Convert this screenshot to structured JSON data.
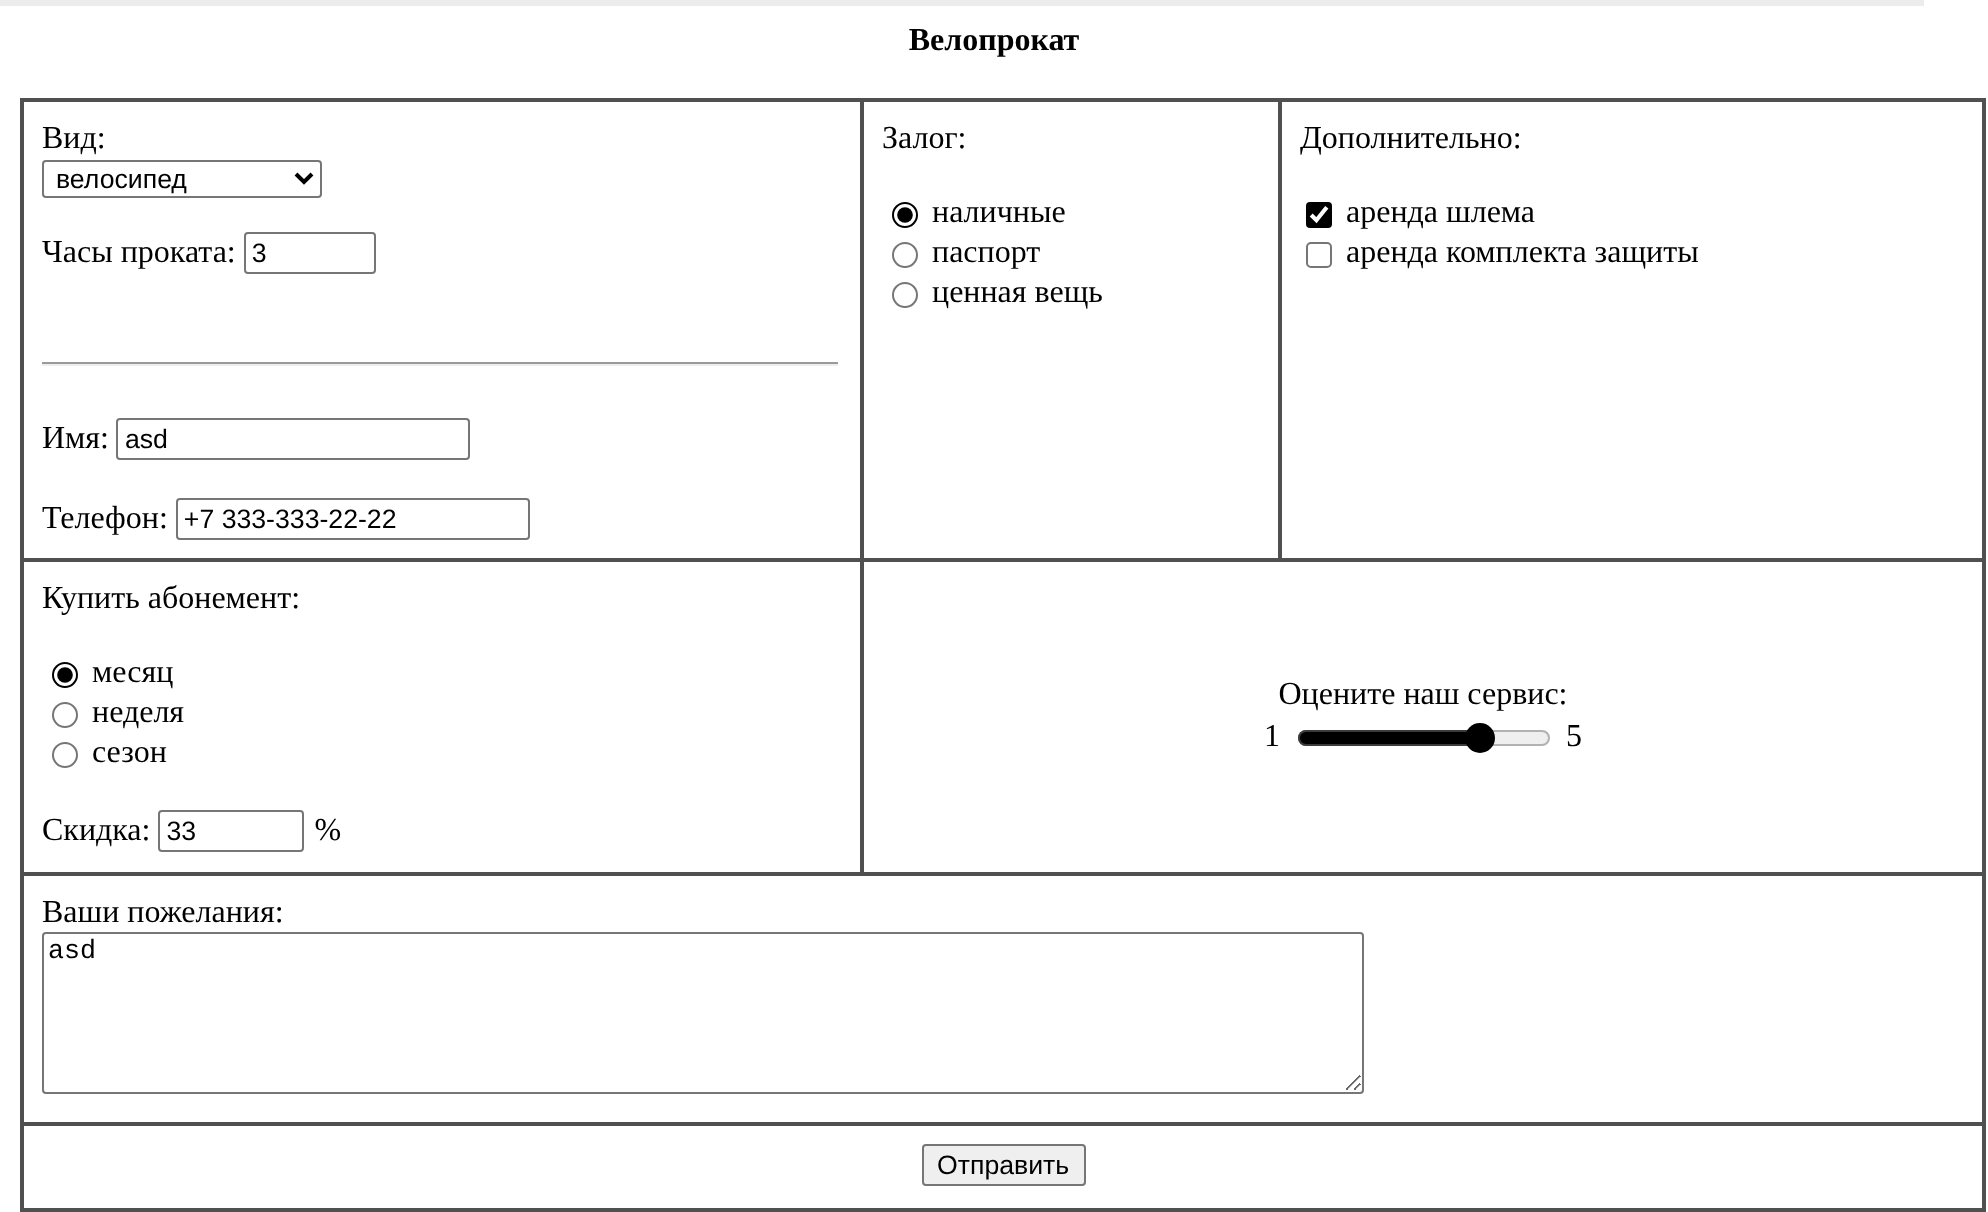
{
  "title": "Велопрокат",
  "rental": {
    "fields": [
      {
        "kind": "select",
        "label": "Вид:",
        "value": "велосипед"
      },
      {
        "kind": "text",
        "label": "Часы проката:",
        "value": "3"
      }
    ]
  },
  "contact": {
    "fields": [
      {
        "kind": "text",
        "label": "Имя:",
        "value": "asd"
      },
      {
        "kind": "text",
        "label": "Телефон:",
        "value": "+7 333-333-22-22"
      }
    ]
  },
  "deposit": {
    "label": "Залог:",
    "options": [
      {
        "label": "наличные",
        "selected": true
      },
      {
        "label": "паспорт",
        "selected": false
      },
      {
        "label": "ценная вещь",
        "selected": false
      }
    ]
  },
  "extras": {
    "label": "Дополнительно:",
    "options": [
      {
        "label": "аренда шлема",
        "checked": true
      },
      {
        "label": "аренда комплекта защиты",
        "checked": false
      }
    ]
  },
  "subscription": {
    "label": "Купить абонемент:",
    "options": [
      {
        "label": "месяц",
        "selected": true
      },
      {
        "label": "неделя",
        "selected": false
      },
      {
        "label": "сезон",
        "selected": false
      }
    ],
    "discount": {
      "label": "Скидка:",
      "value": "33",
      "unit": "%"
    }
  },
  "rating": {
    "label": "Оцените наш сервис:",
    "min_label": "1",
    "max_label": "5",
    "level": 0.75
  },
  "wishes": {
    "label": "Ваши пожелания:",
    "value": "asd"
  },
  "submit_button": {
    "label": "Отправить"
  }
}
